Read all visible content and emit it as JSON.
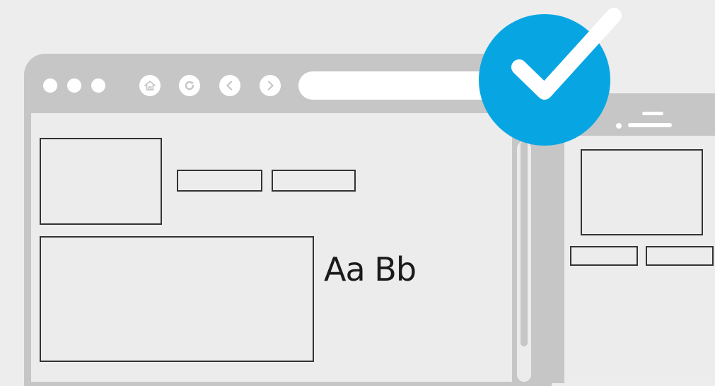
{
  "sample_text": "Aa Bb",
  "colors": {
    "background": "#ededed",
    "frame": "#c6c6c6",
    "content": "#ececec",
    "outline": "#333333",
    "check_badge": "#07a6e3",
    "white": "#ffffff"
  },
  "icons": {
    "window_controls": [
      "dot",
      "dot",
      "dot"
    ],
    "toolbar": [
      "home-icon",
      "refresh-icon",
      "back-icon",
      "forward-icon"
    ],
    "mobile_menu": "hamburger-icon",
    "badge": "checkmark-icon"
  }
}
